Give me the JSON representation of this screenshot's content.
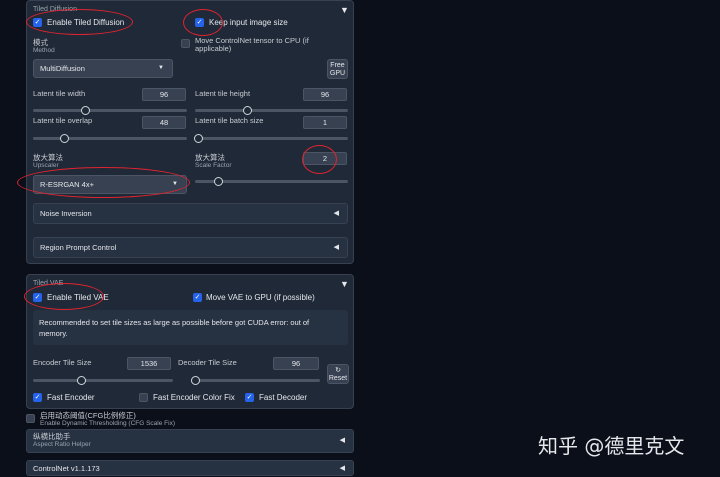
{
  "tiled_diffusion": {
    "title": "Tiled Diffusion",
    "enable_label": "Enable Tiled Diffusion",
    "keep_size_label": "Keep input image size",
    "method_zh": "模式",
    "method_en": "Method",
    "method_value": "MultiDiffusion",
    "move_cn_label": "Move ControlNet tensor to CPU (if applicable)",
    "free_gpu_label": "Free GPU",
    "latent_tile_width_label": "Latent tile width",
    "latent_tile_width_value": "96",
    "latent_tile_height_label": "Latent tile height",
    "latent_tile_height_value": "96",
    "latent_tile_overlap_label": "Latent tile overlap",
    "latent_tile_overlap_value": "48",
    "latent_tile_batch_label": "Latent tile batch size",
    "latent_tile_batch_value": "1",
    "upscaler_zh": "放大算法",
    "upscaler_en": "Upscaler",
    "upscaler_value": "R-ESRGAN 4x+",
    "scale_zh": "放大算法",
    "scale_en": "Scale Factor",
    "scale_value": "2",
    "noise_inversion_label": "Noise Inversion",
    "region_prompt_label": "Region Prompt Control"
  },
  "tiled_vae": {
    "title": "Tiled VAE",
    "enable_label": "Enable Tiled VAE",
    "move_vae_label": "Move VAE to GPU (if possible)",
    "notice": "Recommended to set tile sizes as large as possible before got CUDA error: out of memory.",
    "encoder_label": "Encoder Tile Size",
    "encoder_value": "1536",
    "decoder_label": "Decoder Tile Size",
    "decoder_value": "96",
    "reset_label": "Reset",
    "fast_encoder_label": "Fast Encoder",
    "fast_encoder_color_label": "Fast Encoder Color Fix",
    "fast_decoder_label": "Fast Decoder"
  },
  "dynamic_threshold": {
    "zh": "启用动态阈值(CFG比例修正)",
    "en": "Enable Dynamic Thresholding (CFG Scale Fix)"
  },
  "aspect_ratio": {
    "zh": "纵横比助手",
    "en": "Aspect Ratio Helper"
  },
  "controlnet": {
    "label": "ControlNet v1.1.173"
  },
  "watermark": "知乎 @德里克文",
  "icons": {
    "collapse": "triangle-down",
    "expand": "triangle-left",
    "check": "checkmark"
  },
  "colors": {
    "accent": "#2563eb",
    "annotation": "#e0242f",
    "panel": "#1f2937",
    "background": "#0b0f19"
  }
}
